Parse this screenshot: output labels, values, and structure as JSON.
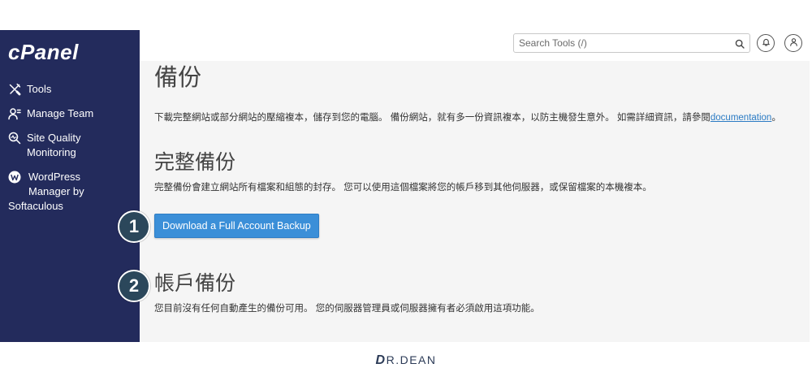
{
  "app": {
    "logo_text": "cPanel"
  },
  "sidebar": {
    "items": [
      {
        "label": "Tools",
        "icon": "tools-icon"
      },
      {
        "label": "Manage Team",
        "icon": "manage-team-icon"
      },
      {
        "label": "Site Quality Monitoring",
        "icon": "site-quality-icon"
      },
      {
        "label": "WordPress Manager by Softaculous",
        "icon": "wordpress-icon"
      }
    ]
  },
  "header": {
    "search": {
      "placeholder": "Search Tools (/)",
      "icon": "search-icon"
    },
    "actions": [
      {
        "icon": "bell-icon"
      },
      {
        "icon": "user-icon"
      }
    ]
  },
  "main": {
    "title": "備份",
    "intro": {
      "text": "下載完整網站或部分網站的壓縮複本，儲存到您的電腦。 備份網站，就有多一份資訊複本，以防主機發生意外。 如需詳細資訊，請參閱",
      "link_text": "documentation",
      "end": "。"
    },
    "full_backup": {
      "heading": "完整備份",
      "description": "完整備份會建立網站所有檔案和組態的封存。 您可以使用這個檔案將您的帳戶移到其他伺服器，或保留檔案的本機複本。",
      "button_label": "Download a Full Account Backup"
    },
    "account_backup": {
      "heading": "帳戶備份",
      "description": "您目前沒有任何自動產生的備份可用。 您的伺服器管理員或伺服器擁有者必須啟用這項功能。"
    }
  },
  "annotations": [
    {
      "label": "1"
    },
    {
      "label": "2"
    }
  ],
  "footer_logo": {
    "mark": "D",
    "text": "R.DEAN"
  },
  "colors": {
    "sidebar_bg": "#232b5c",
    "content_bg": "#f5f5f5",
    "primary_button": "#3b8fd8",
    "primary_button_border": "#2f7ec6",
    "link": "#2b7bc4",
    "badge_bg": "#2b475b",
    "heading_text": "#444444",
    "body_text": "#333333",
    "footer_logo": "#2c3b57"
  }
}
